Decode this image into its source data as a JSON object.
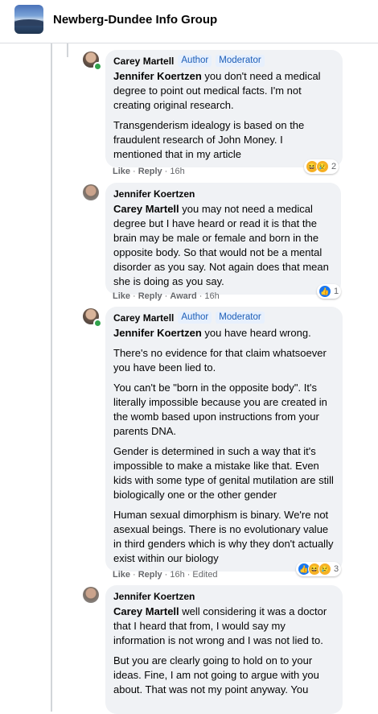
{
  "header": {
    "title": "Newberg-Dundee Info Group"
  },
  "comments": [
    {
      "author": "Carey Martell",
      "badges": [
        "Author",
        "Moderator"
      ],
      "paragraphs": [
        {
          "mention": "Jennifer Koertzen",
          "text": " you don't need a medical degree to point out medical facts. I'm not creating original research."
        },
        {
          "mention": "",
          "text": "Transgenderism idealogy is based on the fraudulent research of John Money. I mentioned that in my article"
        }
      ],
      "actions": {
        "like": "Like",
        "reply": "Reply",
        "time": "16h"
      },
      "reactions": {
        "icons": [
          "haha-icon",
          "sad-icon"
        ],
        "count": "2"
      }
    },
    {
      "author": "Jennifer Koertzen",
      "badges": [],
      "paragraphs": [
        {
          "mention": "Carey Martell",
          "text": " you may not need a medical degree but I have heard or read it is that the brain may be male or female and born in the opposite body. So that would not be a mental disorder as you say. Not again does that mean she is doing as you say."
        }
      ],
      "actions": {
        "like": "Like",
        "reply": "Reply",
        "award": "Award",
        "time": "16h"
      },
      "reactions": {
        "icons": [
          "like-icon"
        ],
        "count": "1"
      }
    },
    {
      "author": "Carey Martell",
      "badges": [
        "Author",
        "Moderator"
      ],
      "paragraphs": [
        {
          "mention": "Jennifer Koertzen",
          "text": " you have heard wrong."
        },
        {
          "mention": "",
          "text": "There's no evidence for that claim whatsoever you have been lied to."
        },
        {
          "mention": "",
          "text": "You can't be \"born in the opposite body\". It's literally impossible because you are created in the womb based upon instructions from your parents DNA."
        },
        {
          "mention": "",
          "text": "Gender is determined in such a way that it's impossible to make a mistake like that. Even kids with some type of genital mutilation are still biologically one or the other gender"
        },
        {
          "mention": "",
          "text": "Human sexual dimorphism is binary. We're not asexual beings. There is no evolutionary value in third genders which is why they don't actually exist within our biology"
        }
      ],
      "actions": {
        "like": "Like",
        "reply": "Reply",
        "time": "16h",
        "edited": "Edited"
      },
      "reactions": {
        "icons": [
          "like-icon",
          "haha-icon",
          "sad-icon"
        ],
        "count": "3"
      }
    },
    {
      "author": "Jennifer Koertzen",
      "badges": [],
      "paragraphs": [
        {
          "mention": "Carey Martell",
          "text": " well considering it was a doctor that I heard that from, I would say my information is not wrong and I was not lied to."
        },
        {
          "mention": "",
          "text": "But you are clearly going to hold on to your ideas. Fine, I am not going to argue with you about. That was not my point anyway. You"
        }
      ]
    }
  ]
}
